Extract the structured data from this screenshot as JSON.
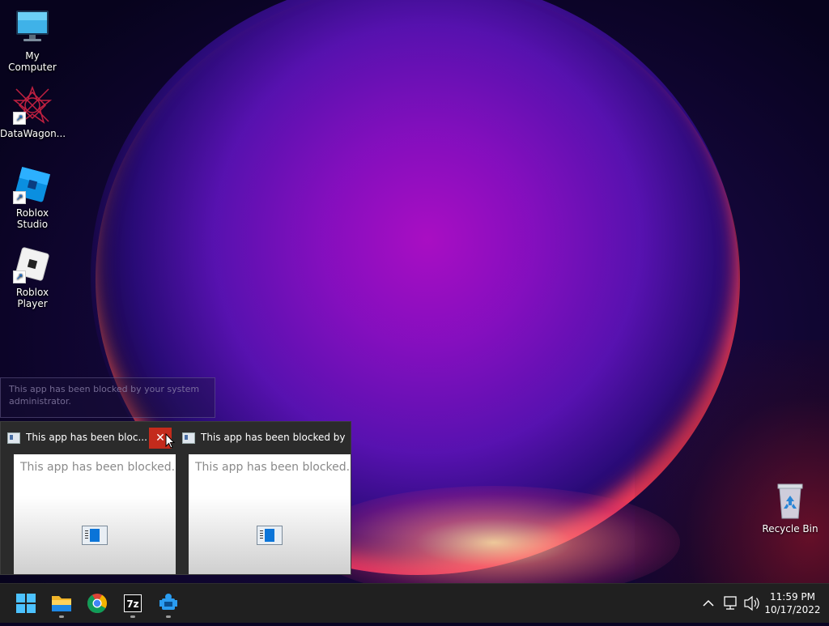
{
  "desktop": {
    "icons": [
      {
        "label": "My Computer",
        "icon": "monitor-icon"
      },
      {
        "label": "DataWagon...",
        "icon": "datawagon-icon"
      },
      {
        "label": "Roblox Studio",
        "icon": "roblox-studio-icon"
      },
      {
        "label": "Roblox Player",
        "icon": "roblox-player-icon"
      }
    ],
    "recycle_bin": {
      "label": "Recycle Bin",
      "icon": "recycle-bin-icon"
    }
  },
  "tooltip": {
    "text": "This app has been blocked by your system administrator."
  },
  "previews": [
    {
      "title": "This app has been bloc...",
      "body": "This app has been blocked...",
      "close_glyph": "✕"
    },
    {
      "title": "This app has been blocked by ...",
      "body": "This app has been blocked..."
    }
  ],
  "taskbar": {
    "items": [
      {
        "name": "start",
        "icon": "windows-start-icon"
      },
      {
        "name": "file-explorer",
        "icon": "folder-icon",
        "running": true
      },
      {
        "name": "chrome",
        "icon": "chrome-icon",
        "running": false
      },
      {
        "name": "7-zip",
        "icon": "7zip-icon",
        "label": "7z",
        "running": true
      },
      {
        "name": "app",
        "icon": "blue-app-icon",
        "running": true
      }
    ],
    "tray": {
      "chevron": "^",
      "clock_time": "11:59 PM",
      "clock_date": "10/17/2022"
    }
  },
  "colors": {
    "taskbar": "#202020",
    "close_button": "#c42b1c",
    "windows_blue": "#0078d4"
  }
}
